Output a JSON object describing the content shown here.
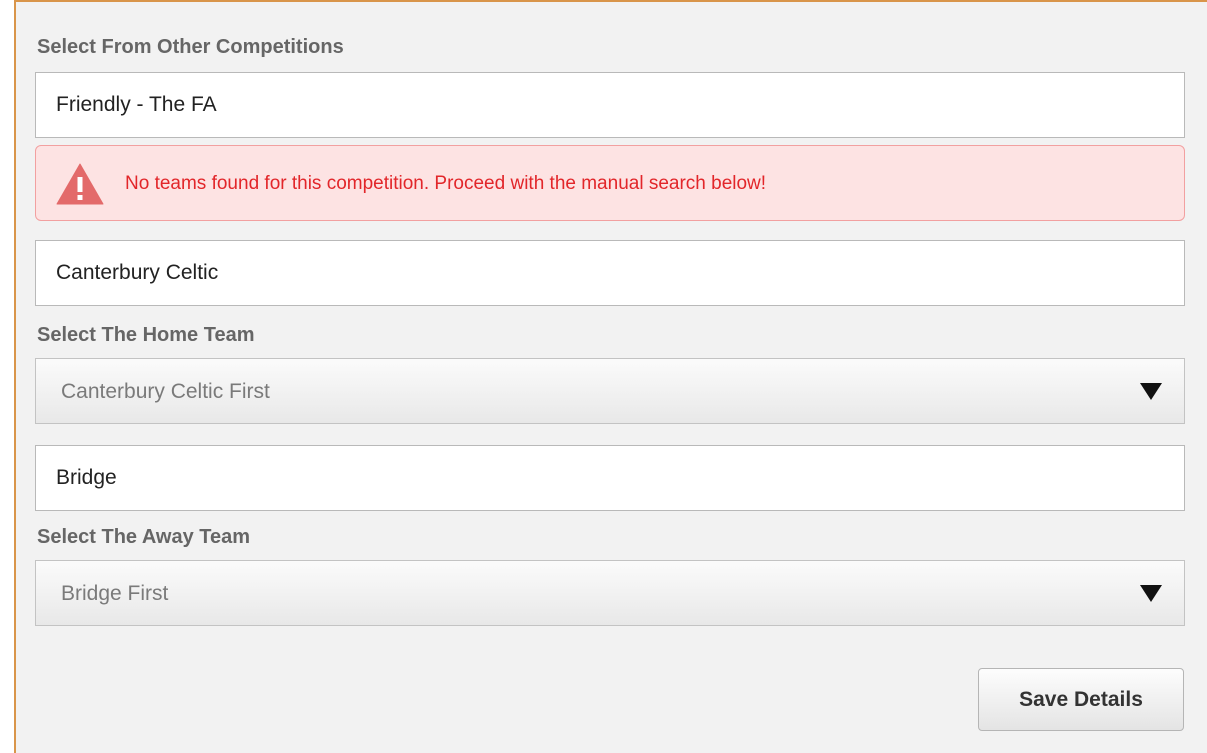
{
  "competition": {
    "label": "Select From Other Competitions",
    "value": "Friendly - The FA"
  },
  "alert": {
    "icon": "warning-triangle-icon",
    "message": "No teams found for this competition. Proceed with the manual search below!",
    "color": "#e2262a"
  },
  "home": {
    "search_value": "Canterbury Celtic",
    "label": "Select The Home Team",
    "selected": "Canterbury Celtic First"
  },
  "away": {
    "search_value": "Bridge",
    "label": "Select The Away Team",
    "selected": "Bridge First"
  },
  "actions": {
    "save_label": "Save Details"
  },
  "colors": {
    "panel_border": "#d9954a",
    "alert_background": "#fde3e3"
  }
}
